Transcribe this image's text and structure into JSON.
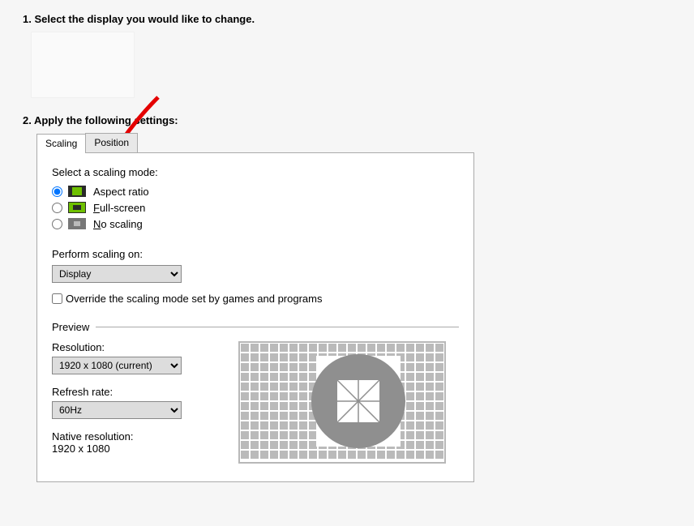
{
  "step1": {
    "heading": "1. Select the display you would like to change."
  },
  "step2": {
    "heading": "2. Apply the following settings:"
  },
  "tabs": {
    "scaling": "Scaling",
    "position": "Position"
  },
  "scaling": {
    "select_label": "Select a scaling mode:",
    "modes": {
      "aspect_ratio": "Aspect ratio",
      "fullscreen_prefix": "F",
      "fullscreen_rest": "ull-screen",
      "noscaling_prefix": "N",
      "noscaling_rest": "o scaling"
    },
    "perform_on_label": "Perform scaling on:",
    "perform_on_value": "Display",
    "override_label": "Override the scaling mode set by games and programs"
  },
  "preview": {
    "title": "Preview",
    "resolution_label": "Resolution:",
    "resolution_value": "1920 x 1080 (current)",
    "refresh_label": "Refresh rate:",
    "refresh_value": "60Hz",
    "native_label": "Native resolution:",
    "native_value": "1920 x 1080"
  }
}
